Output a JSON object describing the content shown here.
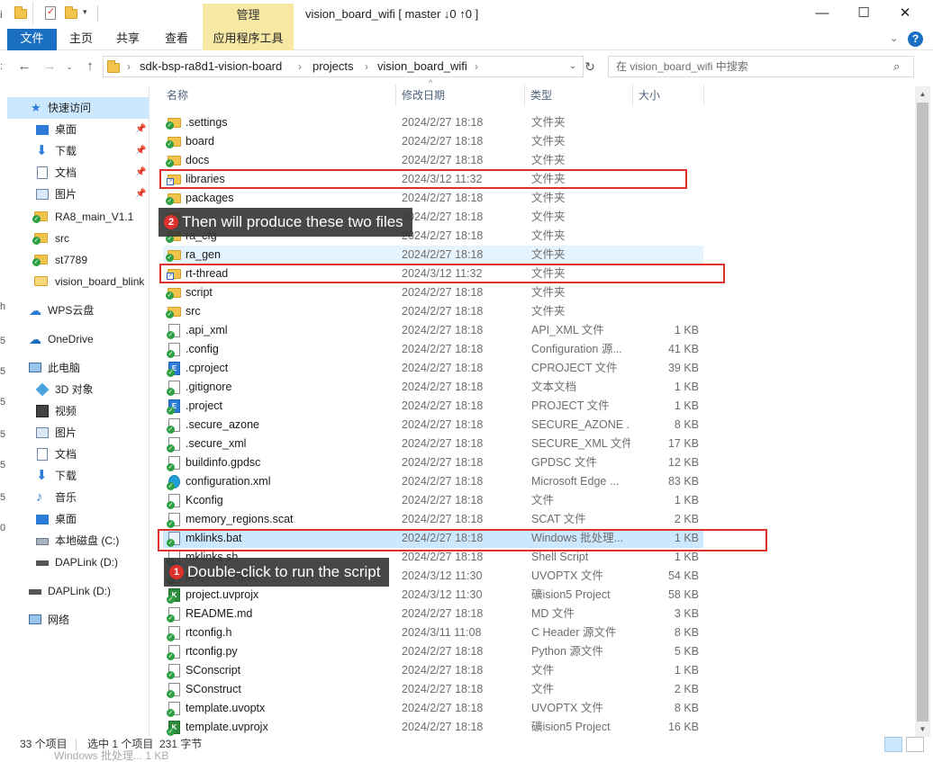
{
  "window": {
    "title": "vision_board_wifi [ master ↓0 ↑0 ]",
    "context_tab": "管理",
    "minimize": "—",
    "maximize": "☐",
    "close": "✕"
  },
  "ribbon": {
    "tabs": [
      "文件",
      "主页",
      "共享",
      "查看",
      "应用程序工具"
    ],
    "help": "?"
  },
  "address": {
    "breadcrumbs": [
      "sdk-bsp-ra8d1-vision-board",
      "projects",
      "vision_board_wifi"
    ],
    "search_placeholder": "在 vision_board_wifi 中搜索"
  },
  "sidebar": {
    "quick_access": "快速访问",
    "pinned": [
      {
        "label": "桌面",
        "icon": "desktop-icon"
      },
      {
        "label": "下载",
        "icon": "download-icon"
      },
      {
        "label": "文档",
        "icon": "documents-icon"
      },
      {
        "label": "图片",
        "icon": "pictures-icon"
      }
    ],
    "recent": [
      {
        "label": "RA8_main_V1.1",
        "icon": "git-folder-icon"
      },
      {
        "label": "src",
        "icon": "git-folder-icon"
      },
      {
        "label": "st7789",
        "icon": "git-folder-icon"
      },
      {
        "label": "vision_board_blink",
        "icon": "folder-icon"
      }
    ],
    "wps": "WPS云盘",
    "onedrive": "OneDrive",
    "this_pc": "此电脑",
    "pc_items": [
      {
        "label": "3D 对象",
        "icon": "3d-objects-icon"
      },
      {
        "label": "视频",
        "icon": "videos-icon"
      },
      {
        "label": "图片",
        "icon": "pictures-icon"
      },
      {
        "label": "文档",
        "icon": "documents-icon"
      },
      {
        "label": "下载",
        "icon": "download-icon"
      },
      {
        "label": "音乐",
        "icon": "music-icon"
      },
      {
        "label": "桌面",
        "icon": "desktop-icon"
      },
      {
        "label": "本地磁盘 (C:)",
        "icon": "local-disk-icon"
      },
      {
        "label": "DAPLink (D:)",
        "icon": "usb-drive-icon"
      }
    ],
    "daplink": "DAPLink (D:)",
    "network": "网络"
  },
  "columns": {
    "name": "名称",
    "date": "修改日期",
    "type": "类型",
    "size": "大小"
  },
  "files": [
    {
      "name": ".settings",
      "date": "2024/2/27 18:18",
      "type": "文件夹",
      "size": "",
      "icon": "git-folder-icon"
    },
    {
      "name": "board",
      "date": "2024/2/27 18:18",
      "type": "文件夹",
      "size": "",
      "icon": "git-folder-icon"
    },
    {
      "name": "docs",
      "date": "2024/2/27 18:18",
      "type": "文件夹",
      "size": "",
      "icon": "git-folder-icon"
    },
    {
      "name": "libraries",
      "date": "2024/3/12 11:32",
      "type": "文件夹",
      "size": "",
      "icon": "link-folder-icon"
    },
    {
      "name": "packages",
      "date": "2024/2/27 18:18",
      "type": "文件夹",
      "size": "",
      "icon": "git-folder-icon"
    },
    {
      "name": "",
      "date": "2024/2/27 18:18",
      "type": "文件夹",
      "size": "",
      "icon": "git-folder-icon"
    },
    {
      "name": "ra_cfg",
      "date": "2024/2/27 18:18",
      "type": "文件夹",
      "size": "",
      "icon": "git-folder-icon"
    },
    {
      "name": "ra_gen",
      "date": "2024/2/27 18:18",
      "type": "文件夹",
      "size": "",
      "icon": "git-folder-icon"
    },
    {
      "name": "rt-thread",
      "date": "2024/3/12 11:32",
      "type": "文件夹",
      "size": "",
      "icon": "link-folder-icon"
    },
    {
      "name": "script",
      "date": "2024/2/27 18:18",
      "type": "文件夹",
      "size": "",
      "icon": "git-folder-icon"
    },
    {
      "name": "src",
      "date": "2024/2/27 18:18",
      "type": "文件夹",
      "size": "",
      "icon": "git-folder-icon"
    },
    {
      "name": ".api_xml",
      "date": "2024/2/27 18:18",
      "type": "API_XML 文件",
      "size": "1 KB",
      "icon": "git-file-icon"
    },
    {
      "name": ".config",
      "date": "2024/2/27 18:18",
      "type": "Configuration 源...",
      "size": "41 KB",
      "icon": "git-file-icon"
    },
    {
      "name": ".cproject",
      "date": "2024/2/27 18:18",
      "type": "CPROJECT 文件",
      "size": "39 KB",
      "icon": "eclipse-file-icon"
    },
    {
      "name": ".gitignore",
      "date": "2024/2/27 18:18",
      "type": "文本文档",
      "size": "1 KB",
      "icon": "git-file-icon"
    },
    {
      "name": ".project",
      "date": "2024/2/27 18:18",
      "type": "PROJECT 文件",
      "size": "1 KB",
      "icon": "eclipse-file-icon"
    },
    {
      "name": ".secure_azone",
      "date": "2024/2/27 18:18",
      "type": "SECURE_AZONE ...",
      "size": "8 KB",
      "icon": "git-file-icon"
    },
    {
      "name": ".secure_xml",
      "date": "2024/2/27 18:18",
      "type": "SECURE_XML 文件",
      "size": "17 KB",
      "icon": "git-file-icon"
    },
    {
      "name": "buildinfo.gpdsc",
      "date": "2024/2/27 18:18",
      "type": "GPDSC 文件",
      "size": "12 KB",
      "icon": "git-file-icon"
    },
    {
      "name": "configuration.xml",
      "date": "2024/2/27 18:18",
      "type": "Microsoft Edge ...",
      "size": "83 KB",
      "icon": "edge-file-icon"
    },
    {
      "name": "Kconfig",
      "date": "2024/2/27 18:18",
      "type": "文件",
      "size": "1 KB",
      "icon": "git-file-icon"
    },
    {
      "name": "memory_regions.scat",
      "date": "2024/2/27 18:18",
      "type": "SCAT 文件",
      "size": "2 KB",
      "icon": "git-file-icon"
    },
    {
      "name": "mklinks.bat",
      "date": "2024/2/27 18:18",
      "type": "Windows 批处理...",
      "size": "1 KB",
      "icon": "batch-file-icon"
    },
    {
      "name": "mklinks.sh",
      "date": "2024/2/27 18:18",
      "type": "Shell Script",
      "size": "1 KB",
      "icon": "git-file-icon"
    },
    {
      "name": "project.uvoptx",
      "date": "2024/3/12 11:30",
      "type": "UVOPTX 文件",
      "size": "54 KB",
      "icon": "git-file-icon"
    },
    {
      "name": "project.uvprojx",
      "date": "2024/3/12 11:30",
      "type": "礦ision5 Project",
      "size": "58 KB",
      "icon": "keil-file-icon"
    },
    {
      "name": "README.md",
      "date": "2024/2/27 18:18",
      "type": "MD 文件",
      "size": "3 KB",
      "icon": "git-file-icon"
    },
    {
      "name": "rtconfig.h",
      "date": "2024/3/11 11:08",
      "type": "C Header 源文件",
      "size": "8 KB",
      "icon": "git-file-icon"
    },
    {
      "name": "rtconfig.py",
      "date": "2024/2/27 18:18",
      "type": "Python 源文件",
      "size": "5 KB",
      "icon": "git-file-icon"
    },
    {
      "name": "SConscript",
      "date": "2024/2/27 18:18",
      "type": "文件",
      "size": "1 KB",
      "icon": "git-file-icon"
    },
    {
      "name": "SConstruct",
      "date": "2024/2/27 18:18",
      "type": "文件",
      "size": "2 KB",
      "icon": "git-file-icon"
    },
    {
      "name": "template.uvoptx",
      "date": "2024/2/27 18:18",
      "type": "UVOPTX 文件",
      "size": "8 KB",
      "icon": "git-file-icon"
    },
    {
      "name": "template.uvprojx",
      "date": "2024/2/27 18:18",
      "type": "礦ision5 Project",
      "size": "16 KB",
      "icon": "keil-file-icon"
    }
  ],
  "callouts": {
    "first": {
      "num": "1",
      "text": "Double-click to run the script"
    },
    "second": {
      "num": "2",
      "text": "Then will produce these two files"
    }
  },
  "status": {
    "count": "33 个项目",
    "selection": "选中 1 个项目  231 字节"
  },
  "ghost_text": "Windows 批处理...  1 KB",
  "colors": {
    "accent": "#1a6fc2",
    "context_tab": "#f7e8a4",
    "highlight_red": "#e0302b",
    "selection": "#cce8ff",
    "hover": "#e5f3ff"
  }
}
